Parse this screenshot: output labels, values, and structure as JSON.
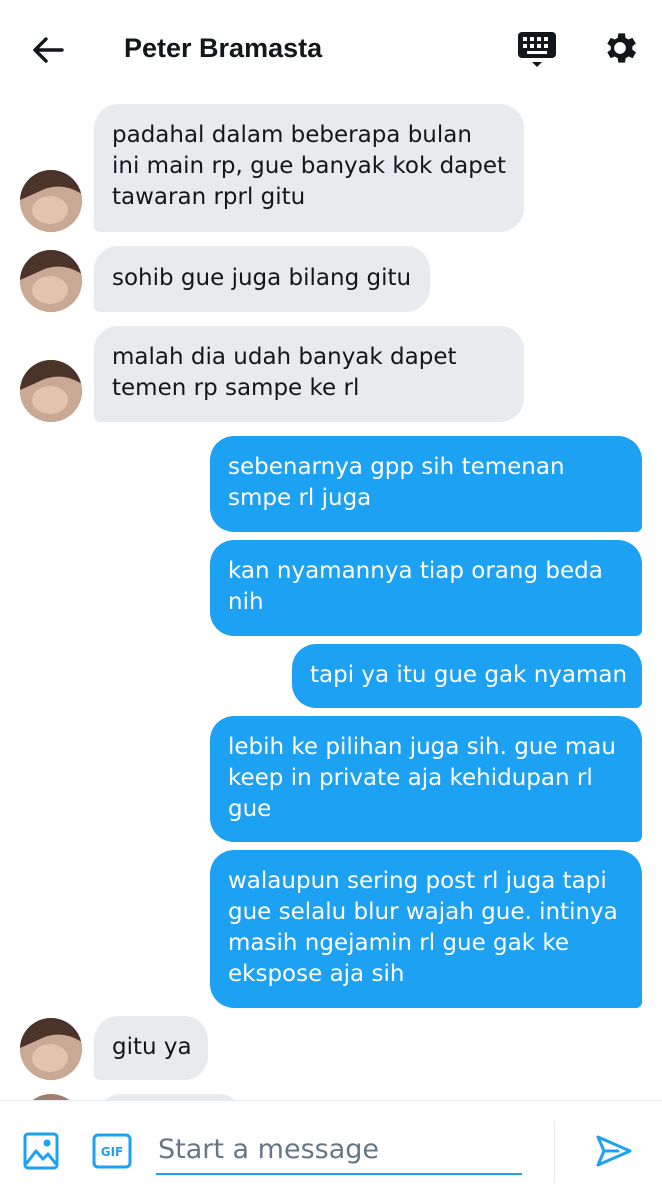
{
  "header": {
    "title": "Peter Bramasta",
    "back_icon": "arrow-left-icon",
    "keyboard_icon": "keyboard-icon",
    "settings_icon": "gear-icon"
  },
  "colors": {
    "accent": "#1da1f2",
    "incoming_bubble": "#e7ebee",
    "text": "#14171a"
  },
  "messages": [
    {
      "direction": "in",
      "lines": [
        "padahal dalam beberapa bulan",
        "ini main rp, gue banyak kok dapet",
        "tawaran rprl gitu"
      ]
    },
    {
      "direction": "in",
      "lines": [
        "sohib gue juga bilang gitu"
      ]
    },
    {
      "direction": "in",
      "lines": [
        "malah dia udah banyak dapet",
        "temen rp sampe ke rl"
      ]
    },
    {
      "direction": "out",
      "lines": [
        "sebenarnya gpp sih temenan",
        "smpe rl juga"
      ]
    },
    {
      "direction": "out",
      "lines": [
        "kan nyamannya tiap orang beda",
        "nih"
      ]
    },
    {
      "direction": "out",
      "lines": [
        "tapi ya itu gue gak nyaman"
      ]
    },
    {
      "direction": "out",
      "lines": [
        "lebih ke pilihan juga sih. gue mau",
        "keep in private aja kehidupan rl",
        "gue"
      ]
    },
    {
      "direction": "out",
      "lines": [
        "walaupun sering post rl juga tapi",
        "gue selalu blur wajah gue. intinya",
        "masih ngejamin rl gue gak ke",
        "ekspose aja sih"
      ]
    },
    {
      "direction": "in",
      "lines": [
        "gitu ya"
      ]
    }
  ],
  "composer": {
    "placeholder": "Start a message",
    "gif_label": "GIF",
    "image_icon": "image-icon",
    "send_icon": "send-icon"
  }
}
